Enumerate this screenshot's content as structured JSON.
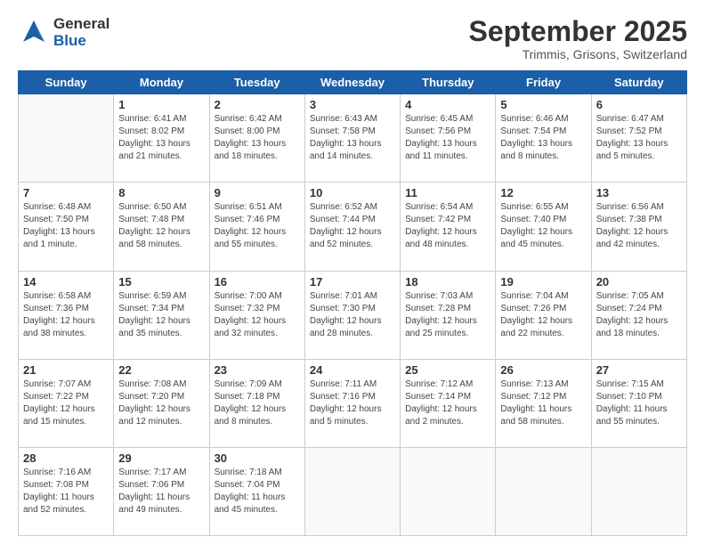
{
  "header": {
    "logo_general": "General",
    "logo_blue": "Blue",
    "month_title": "September 2025",
    "location": "Trimmis, Grisons, Switzerland"
  },
  "weekdays": [
    "Sunday",
    "Monday",
    "Tuesday",
    "Wednesday",
    "Thursday",
    "Friday",
    "Saturday"
  ],
  "weeks": [
    [
      {
        "day": "",
        "info": ""
      },
      {
        "day": "1",
        "info": "Sunrise: 6:41 AM\nSunset: 8:02 PM\nDaylight: 13 hours\nand 21 minutes."
      },
      {
        "day": "2",
        "info": "Sunrise: 6:42 AM\nSunset: 8:00 PM\nDaylight: 13 hours\nand 18 minutes."
      },
      {
        "day": "3",
        "info": "Sunrise: 6:43 AM\nSunset: 7:58 PM\nDaylight: 13 hours\nand 14 minutes."
      },
      {
        "day": "4",
        "info": "Sunrise: 6:45 AM\nSunset: 7:56 PM\nDaylight: 13 hours\nand 11 minutes."
      },
      {
        "day": "5",
        "info": "Sunrise: 6:46 AM\nSunset: 7:54 PM\nDaylight: 13 hours\nand 8 minutes."
      },
      {
        "day": "6",
        "info": "Sunrise: 6:47 AM\nSunset: 7:52 PM\nDaylight: 13 hours\nand 5 minutes."
      }
    ],
    [
      {
        "day": "7",
        "info": "Sunrise: 6:48 AM\nSunset: 7:50 PM\nDaylight: 13 hours\nand 1 minute."
      },
      {
        "day": "8",
        "info": "Sunrise: 6:50 AM\nSunset: 7:48 PM\nDaylight: 12 hours\nand 58 minutes."
      },
      {
        "day": "9",
        "info": "Sunrise: 6:51 AM\nSunset: 7:46 PM\nDaylight: 12 hours\nand 55 minutes."
      },
      {
        "day": "10",
        "info": "Sunrise: 6:52 AM\nSunset: 7:44 PM\nDaylight: 12 hours\nand 52 minutes."
      },
      {
        "day": "11",
        "info": "Sunrise: 6:54 AM\nSunset: 7:42 PM\nDaylight: 12 hours\nand 48 minutes."
      },
      {
        "day": "12",
        "info": "Sunrise: 6:55 AM\nSunset: 7:40 PM\nDaylight: 12 hours\nand 45 minutes."
      },
      {
        "day": "13",
        "info": "Sunrise: 6:56 AM\nSunset: 7:38 PM\nDaylight: 12 hours\nand 42 minutes."
      }
    ],
    [
      {
        "day": "14",
        "info": "Sunrise: 6:58 AM\nSunset: 7:36 PM\nDaylight: 12 hours\nand 38 minutes."
      },
      {
        "day": "15",
        "info": "Sunrise: 6:59 AM\nSunset: 7:34 PM\nDaylight: 12 hours\nand 35 minutes."
      },
      {
        "day": "16",
        "info": "Sunrise: 7:00 AM\nSunset: 7:32 PM\nDaylight: 12 hours\nand 32 minutes."
      },
      {
        "day": "17",
        "info": "Sunrise: 7:01 AM\nSunset: 7:30 PM\nDaylight: 12 hours\nand 28 minutes."
      },
      {
        "day": "18",
        "info": "Sunrise: 7:03 AM\nSunset: 7:28 PM\nDaylight: 12 hours\nand 25 minutes."
      },
      {
        "day": "19",
        "info": "Sunrise: 7:04 AM\nSunset: 7:26 PM\nDaylight: 12 hours\nand 22 minutes."
      },
      {
        "day": "20",
        "info": "Sunrise: 7:05 AM\nSunset: 7:24 PM\nDaylight: 12 hours\nand 18 minutes."
      }
    ],
    [
      {
        "day": "21",
        "info": "Sunrise: 7:07 AM\nSunset: 7:22 PM\nDaylight: 12 hours\nand 15 minutes."
      },
      {
        "day": "22",
        "info": "Sunrise: 7:08 AM\nSunset: 7:20 PM\nDaylight: 12 hours\nand 12 minutes."
      },
      {
        "day": "23",
        "info": "Sunrise: 7:09 AM\nSunset: 7:18 PM\nDaylight: 12 hours\nand 8 minutes."
      },
      {
        "day": "24",
        "info": "Sunrise: 7:11 AM\nSunset: 7:16 PM\nDaylight: 12 hours\nand 5 minutes."
      },
      {
        "day": "25",
        "info": "Sunrise: 7:12 AM\nSunset: 7:14 PM\nDaylight: 12 hours\nand 2 minutes."
      },
      {
        "day": "26",
        "info": "Sunrise: 7:13 AM\nSunset: 7:12 PM\nDaylight: 11 hours\nand 58 minutes."
      },
      {
        "day": "27",
        "info": "Sunrise: 7:15 AM\nSunset: 7:10 PM\nDaylight: 11 hours\nand 55 minutes."
      }
    ],
    [
      {
        "day": "28",
        "info": "Sunrise: 7:16 AM\nSunset: 7:08 PM\nDaylight: 11 hours\nand 52 minutes."
      },
      {
        "day": "29",
        "info": "Sunrise: 7:17 AM\nSunset: 7:06 PM\nDaylight: 11 hours\nand 49 minutes."
      },
      {
        "day": "30",
        "info": "Sunrise: 7:18 AM\nSunset: 7:04 PM\nDaylight: 11 hours\nand 45 minutes."
      },
      {
        "day": "",
        "info": ""
      },
      {
        "day": "",
        "info": ""
      },
      {
        "day": "",
        "info": ""
      },
      {
        "day": "",
        "info": ""
      }
    ]
  ]
}
